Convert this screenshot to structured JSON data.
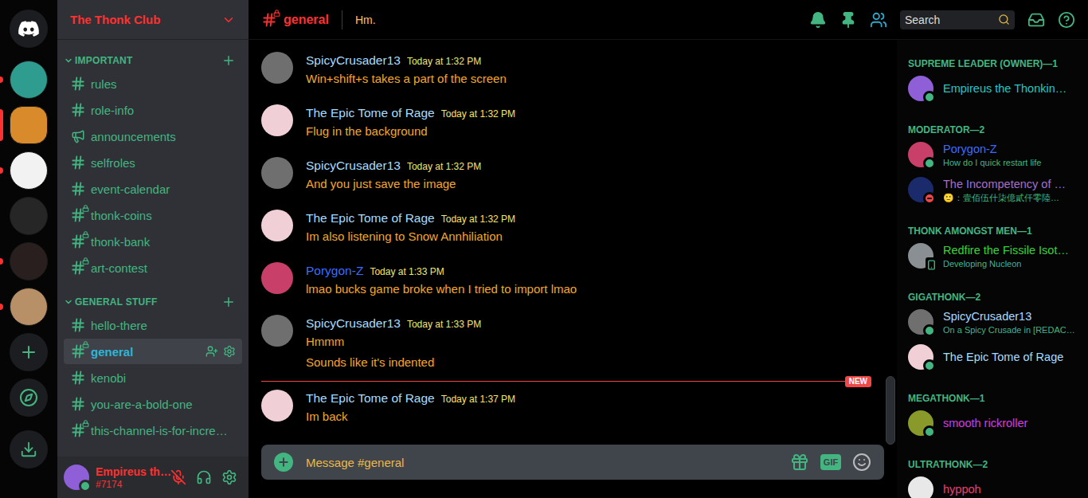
{
  "server_rail": {
    "servers": [
      {
        "color": "#2e9c8f",
        "unread": true,
        "selected": false
      },
      {
        "color": "#d98a2b",
        "unread": false,
        "selected": true
      },
      {
        "color": "#f2f2f2",
        "unread": true,
        "selected": false
      },
      {
        "color": "#262626",
        "unread": false,
        "selected": false
      },
      {
        "color": "#2a1f1f",
        "unread": true,
        "selected": false
      },
      {
        "color": "#b89068",
        "unread": true,
        "selected": false
      }
    ]
  },
  "guild": {
    "name": "The Thonk Club"
  },
  "categories": [
    {
      "name": "IMPORTANT",
      "channels": [
        {
          "name": "rules",
          "kind": "text",
          "selected": false
        },
        {
          "name": "role-info",
          "kind": "text",
          "selected": false
        },
        {
          "name": "announcements",
          "kind": "announcement",
          "selected": false
        },
        {
          "name": "selfroles",
          "kind": "text",
          "selected": false
        },
        {
          "name": "event-calendar",
          "kind": "text",
          "selected": false
        },
        {
          "name": "thonk-coins",
          "kind": "locked",
          "selected": false
        },
        {
          "name": "thonk-bank",
          "kind": "locked",
          "selected": false
        },
        {
          "name": "art-contest",
          "kind": "locked",
          "selected": false
        }
      ]
    },
    {
      "name": "GENERAL STUFF",
      "channels": [
        {
          "name": "hello-there",
          "kind": "text",
          "selected": false
        },
        {
          "name": "general",
          "kind": "locked",
          "selected": true
        },
        {
          "name": "kenobi",
          "kind": "text",
          "selected": false
        },
        {
          "name": "you-are-a-bold-one",
          "kind": "text",
          "selected": false
        },
        {
          "name": "this-channel-is-for-incre…",
          "kind": "locked",
          "selected": false
        }
      ]
    }
  ],
  "user_panel": {
    "name": "Empireus th…",
    "tag": "#7174",
    "avatar_color": "#8e5fd6",
    "status": "online",
    "muted": true
  },
  "header": {
    "channel": "general",
    "kind": "locked",
    "topic": "Hm.",
    "search_placeholder": "Search"
  },
  "messages": [
    {
      "author": "SpicyCrusader13",
      "color": "#a9dcff",
      "avatar_color": "#6f6f6f",
      "time": "Today at 1:32 PM",
      "lines": [
        "Win+shift+s takes a part of the screen"
      ],
      "new_marker_before": false
    },
    {
      "author": "The Epic Tome of Rage",
      "color": "#a9dcff",
      "avatar_color": "#f0d0d6",
      "time": "Today at 1:32 PM",
      "lines": [
        "Flug in the background"
      ],
      "new_marker_before": false
    },
    {
      "author": "SpicyCrusader13",
      "color": "#a9dcff",
      "avatar_color": "#6f6f6f",
      "time": "Today at 1:32 PM",
      "lines": [
        "And you just save the image"
      ],
      "new_marker_before": false
    },
    {
      "author": "The Epic Tome of Rage",
      "color": "#a9dcff",
      "avatar_color": "#f0d0d6",
      "time": "Today at 1:32 PM",
      "lines": [
        "Im also listening to Snow Annhiliation"
      ],
      "new_marker_before": false
    },
    {
      "author": "Porygon-Z",
      "color": "#3c6cff",
      "avatar_color": "#c8406a",
      "time": "Today at 1:33 PM",
      "lines": [
        "lmao bucks game broke when I tried to import lmao"
      ],
      "new_marker_before": false
    },
    {
      "author": "SpicyCrusader13",
      "color": "#a9dcff",
      "avatar_color": "#6f6f6f",
      "time": "Today at 1:33 PM",
      "lines": [
        "Hmmm",
        "Sounds like it's indented"
      ],
      "new_marker_before": false
    },
    {
      "author": "The Epic Tome of Rage",
      "color": "#a9dcff",
      "avatar_color": "#f0d0d6",
      "time": "Today at 1:37 PM",
      "lines": [
        "Im back"
      ],
      "new_marker_before": true
    }
  ],
  "new_badge": "NEW",
  "scrollbar": {
    "level": 1
  },
  "composer": {
    "placeholder": "Message #general",
    "gif_label": "GIF"
  },
  "member_groups": [
    {
      "title": "SUPREME LEADER (OWNER)—1",
      "members": [
        {
          "name": "Empireus the Thonkin…",
          "color": "#22c7c2",
          "avatar_color": "#8e5fd6",
          "status": "online"
        }
      ]
    },
    {
      "title": "MODERATOR—2",
      "members": [
        {
          "name": "Porygon-Z",
          "color": "#3c6cff",
          "avatar_color": "#c8406a",
          "status": "online",
          "activity": "How do I quick restart life"
        },
        {
          "name": "The Incompetency of …",
          "color": "#a36fd0",
          "avatar_color": "#1b2a6b",
          "status": "dnd",
          "activity": "🙂：壹佰伍什柒億貳仟零陸…"
        }
      ]
    },
    {
      "title": "THONK AMONGST MEN—1",
      "members": [
        {
          "name": "Redfire the Fissile Isot…",
          "color": "#35d435",
          "avatar_color": "#8a8f94",
          "status": "mobile",
          "activity": "Developing Nucleon"
        }
      ]
    },
    {
      "title": "GIGATHONK—2",
      "members": [
        {
          "name": "SpicyCrusader13",
          "color": "#a9dcff",
          "avatar_color": "#6f6f6f",
          "status": "online",
          "activity": "On a Spicy Crusade in [REDAC…"
        },
        {
          "name": "The Epic Tome of Rage",
          "color": "#a9dcff",
          "avatar_color": "#f0d0d6",
          "status": "online"
        }
      ]
    },
    {
      "title": "MEGATHONK—1",
      "members": [
        {
          "name": "smooth rickroller",
          "color": "#d63ae0",
          "avatar_color": "#8a9a2a",
          "status": "online"
        }
      ]
    },
    {
      "title": "ULTRATHONK—2",
      "members": [
        {
          "name": "hyppoh",
          "color": "#ee3e6e",
          "avatar_color": "#e8e8e8"
        }
      ]
    }
  ]
}
